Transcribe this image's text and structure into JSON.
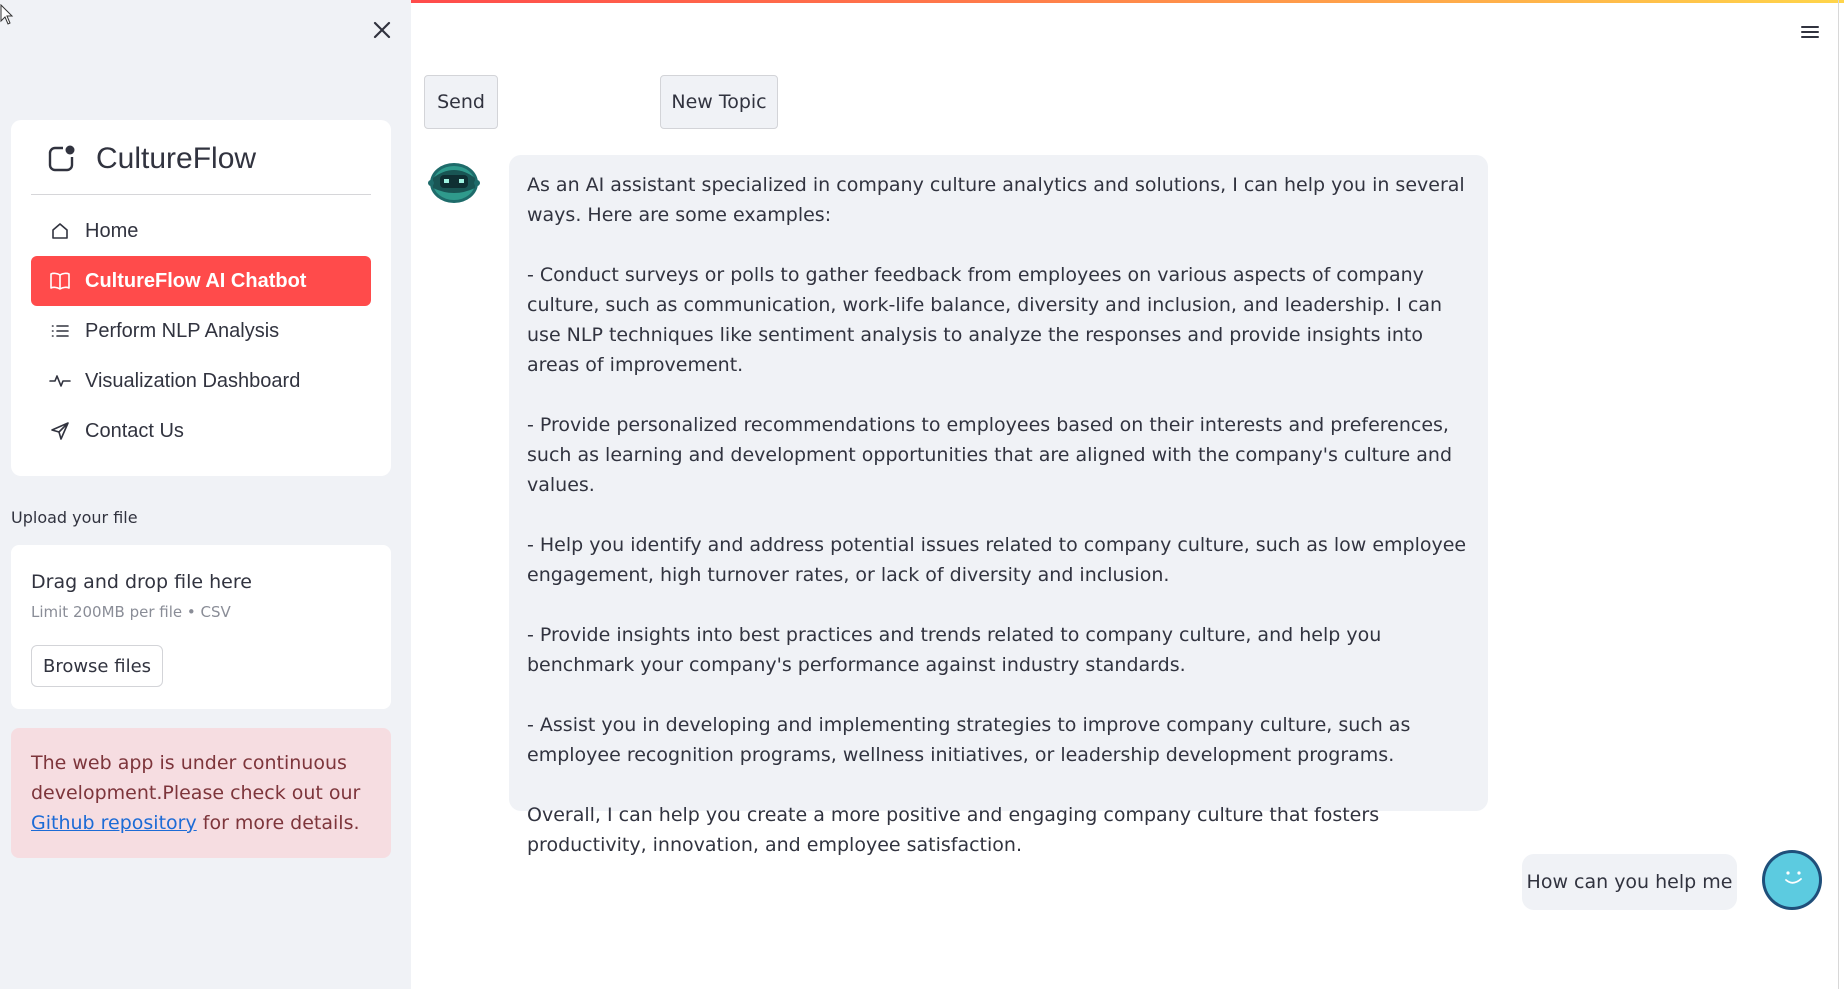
{
  "sidebar": {
    "brand": {
      "title": "CultureFlow"
    },
    "nav": [
      {
        "label": "Home",
        "icon": "home-icon",
        "active": false
      },
      {
        "label": "CultureFlow AI Chatbot",
        "icon": "book-icon",
        "active": true
      },
      {
        "label": "Perform NLP Analysis",
        "icon": "list-icon",
        "active": false
      },
      {
        "label": "Visualization Dashboard",
        "icon": "activity-icon",
        "active": false
      },
      {
        "label": "Contact Us",
        "icon": "send-icon",
        "active": false
      }
    ],
    "upload": {
      "label": "Upload your file",
      "drop_title": "Drag and drop file here",
      "limit": "Limit 200MB per file • CSV",
      "browse_label": "Browse files"
    },
    "notice": {
      "text_before": "The web app is under continuous development.Please check out our ",
      "link": "Github repository",
      "text_after": " for more details."
    }
  },
  "main": {
    "send_label": "Send",
    "new_topic_label": "New Topic",
    "bot_message": "As an AI assistant specialized in company culture analytics and solutions, I can help you in several ways. Here are some examples:\n\n- Conduct surveys or polls to gather feedback from employees on various aspects of company culture, such as communication, work-life balance, diversity and inclusion, and leadership. I can use NLP techniques like sentiment analysis to analyze the responses and provide insights into areas of improvement.\n\n- Provide personalized recommendations to employees based on their interests and preferences, such as learning and development opportunities that are aligned with the company's culture and values.\n\n- Help you identify and address potential issues related to company culture, such as low employee engagement, high turnover rates, or lack of diversity and inclusion.\n\n- Provide insights into best practices and trends related to company culture, and help you benchmark your company's performance against industry standards.\n\n- Assist you in developing and implementing strategies to improve company culture, such as employee recognition programs, wellness initiatives, or leadership development programs.\n\nOverall, I can help you create a more positive and engaging company culture that fosters productivity, innovation, and employee satisfaction.",
    "user_message": "How can you help me"
  },
  "colors": {
    "accent": "#ff4b4b",
    "sidebar_bg": "#f0f2f6",
    "notice_bg": "#f6dde1",
    "user_avatar": "#5ccbe0"
  }
}
